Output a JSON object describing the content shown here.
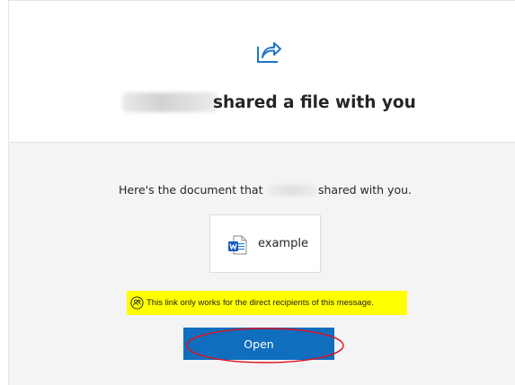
{
  "header": {
    "title_suffix": "shared a file with you",
    "icon": "share-icon"
  },
  "body": {
    "sentence_part1": "Here's the document that",
    "sentence_part2": "shared with you.",
    "file": {
      "name": "example",
      "icon": "word-document-icon"
    },
    "notice": {
      "text": "This link only works for the direct recipients of this message.",
      "icon": "people-icon",
      "highlight_color": "#ffff00"
    },
    "open_button": {
      "label": "Open",
      "color": "#106ebe",
      "annotation_color": "#e0101c"
    }
  }
}
